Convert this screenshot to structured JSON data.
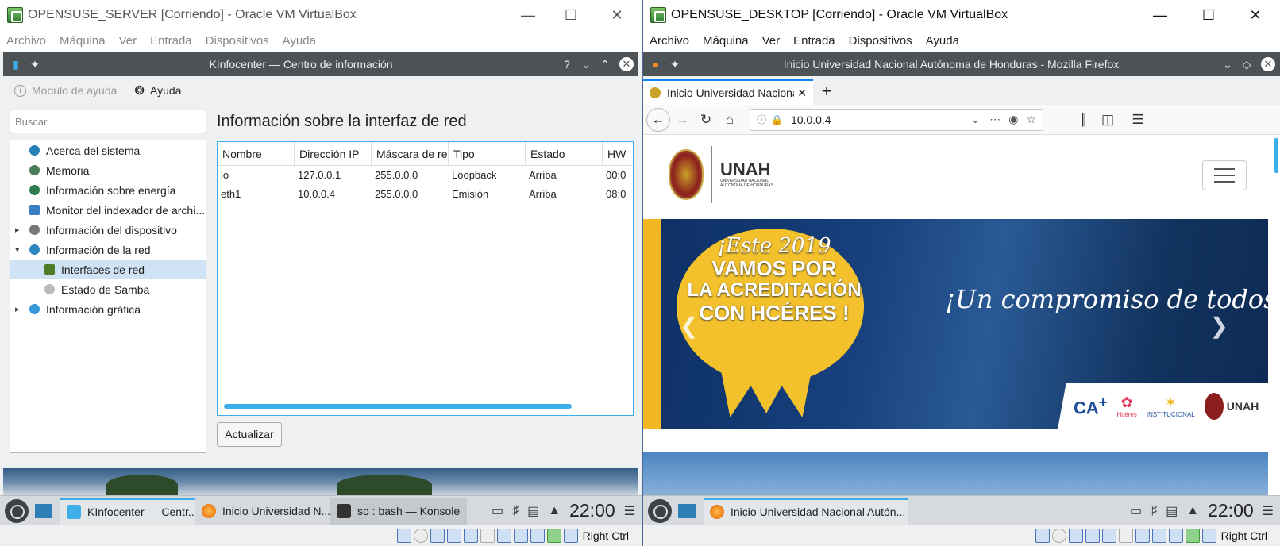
{
  "left_window": {
    "title": "OPENSUSE_SERVER [Corriendo] - Oracle VM VirtualBox",
    "menu": [
      "Archivo",
      "Máquina",
      "Ver",
      "Entrada",
      "Dispositivos",
      "Ayuda"
    ],
    "kinfo": {
      "window_title": "KInfocenter — Centro de información",
      "help_q": "?",
      "toolbar": {
        "module_help": "Módulo de ayuda",
        "help": "Ayuda"
      },
      "search_placeholder": "Buscar",
      "tree": [
        {
          "label": "Acerca del sistema",
          "icon": "info-icon",
          "color": "#2980b9"
        },
        {
          "label": "Memoria",
          "icon": "memory-icon",
          "color": "#4a7c59"
        },
        {
          "label": "Información sobre energía",
          "icon": "energy-icon",
          "color": "#2e7d4f"
        },
        {
          "label": "Monitor del indexador de archi...",
          "icon": "file-index-icon",
          "color": "#3d7fc4"
        },
        {
          "label": "Información del dispositivo",
          "icon": "device-icon",
          "color": "#777"
        },
        {
          "label": "Información de la red",
          "icon": "network-icon",
          "color": "#2e86c1"
        },
        {
          "label": "Interfaces de red",
          "icon": "network-card-icon",
          "color": "#4f7a28"
        },
        {
          "label": "Estado de Samba",
          "icon": "samba-icon",
          "color": "#999"
        },
        {
          "label": "Información gráfica",
          "icon": "graphics-icon",
          "color": "#3498db"
        }
      ],
      "heading": "Información sobre la interfaz de red",
      "table": {
        "columns": [
          "Nombre",
          "Dirección IP",
          "Máscara de red",
          "Tipo",
          "Estado",
          "HW"
        ],
        "rows": [
          [
            "lo",
            "127.0.0.1",
            "255.0.0.0",
            "Loopback",
            "Arriba",
            "00:0"
          ],
          [
            "eth1",
            "10.0.0.4",
            "255.0.0.0",
            "Emisión",
            "Arriba",
            "08:0"
          ]
        ]
      },
      "refresh_button": "Actualizar"
    },
    "taskbar": {
      "tasks": [
        "KInfocenter — Centr...",
        "Inicio Universidad N...",
        "so : bash — Konsole"
      ],
      "clock": "22:00"
    },
    "hostkey": "Right Ctrl"
  },
  "right_window": {
    "title": "OPENSUSE_DESKTOP [Corriendo] - Oracle VM VirtualBox",
    "menu": [
      "Archivo",
      "Máquina",
      "Ver",
      "Entrada",
      "Dispositivos",
      "Ayuda"
    ],
    "firefox": {
      "window_title": "Inicio Universidad Nacional Autónoma de Honduras - Mozilla Firefox",
      "tab_title": "Inicio Universidad Nacional",
      "url": "10.0.0.4",
      "page": {
        "brand": "UNAH",
        "brand_sub": "UNIVERSIDAD NACIONAL AUTÓNOMA DE HONDURAS",
        "banner_line1": "¡Este 2019",
        "banner_line2": "VAMOS POR",
        "banner_line3": "LA ACREDITACIÓN",
        "banner_line4": "CON HCÉRES !",
        "slogan": "¡Un compromiso de todos!",
        "logo_hceres": "Hcéres",
        "logo_institutional": "INSTITUCIONAL",
        "logo_unah": "UNAH"
      }
    },
    "taskbar": {
      "tasks": [
        "Inicio Universidad Nacional Autón..."
      ],
      "clock": "22:00"
    },
    "hostkey": "Right Ctrl"
  }
}
